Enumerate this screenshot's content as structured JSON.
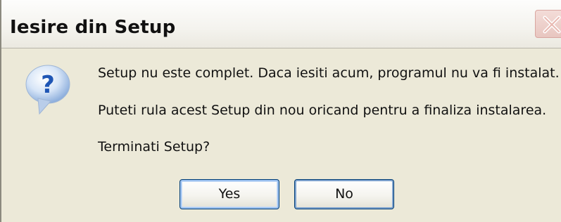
{
  "window": {
    "title": "Iesire din Setup",
    "close_icon": "close-x-icon"
  },
  "content": {
    "icon": "question-icon",
    "icon_glyph": "?",
    "line1": "Setup nu este complet. Daca iesiti acum, programul nu va fi instalat.",
    "line2": "Puteti rula acest Setup din nou oricand pentru a finaliza instalarea.",
    "line3": "Terminati Setup?"
  },
  "buttons": {
    "yes": "Yes",
    "no": "No"
  },
  "colors": {
    "dialog_bg": "#ece9d8",
    "button_border": "#003c74",
    "icon_blue": "#1f56b5"
  }
}
